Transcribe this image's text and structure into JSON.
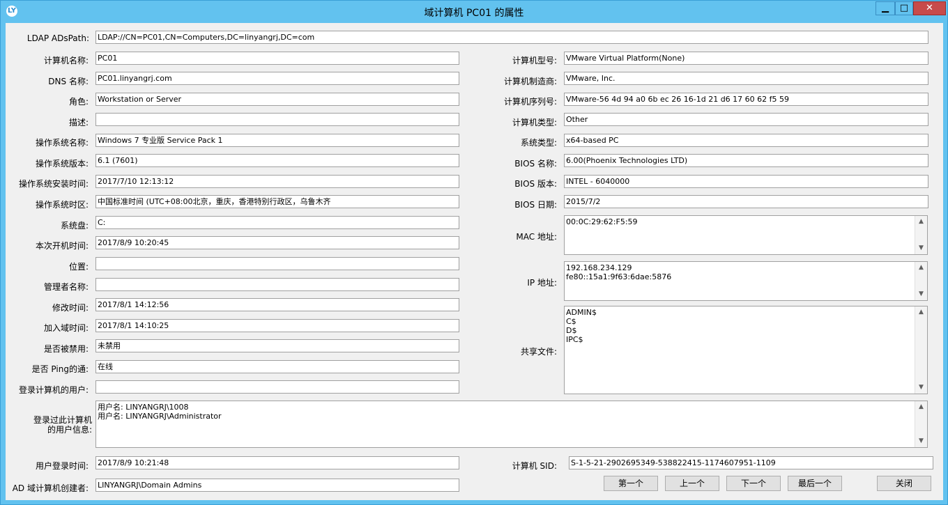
{
  "window": {
    "title": "域计算机 PC01 的属性",
    "icon_text": "LY",
    "controls": {
      "minimize": "▁",
      "maximize": "□",
      "close": "✕"
    }
  },
  "form": {
    "ldap": {
      "label": "LDAP ADsPath:",
      "value": "LDAP://CN=PC01,CN=Computers,DC=linyangrj,DC=com"
    },
    "left": [
      {
        "label": "计算机名称:",
        "value": "PC01"
      },
      {
        "label": "DNS 名称:",
        "value": "PC01.linyangrj.com"
      },
      {
        "label": "角色:",
        "value": "Workstation or Server"
      },
      {
        "label": "描述:",
        "value": ""
      },
      {
        "label": "操作系统名称:",
        "value": "Windows 7 专业版 Service Pack 1"
      },
      {
        "label": "操作系统版本:",
        "value": "6.1 (7601)"
      },
      {
        "label": "操作系统安装时间:",
        "value": "2017/7/10 12:13:12"
      },
      {
        "label": "操作系统时区:",
        "value": "中国标准时间 (UTC+08:00北京，重庆，香港特别行政区，乌鲁木齐"
      },
      {
        "label": "系统盘:",
        "value": "C:"
      },
      {
        "label": "本次开机时间:",
        "value": "2017/8/9 10:20:45"
      },
      {
        "label": "位置:",
        "value": ""
      },
      {
        "label": "管理者名称:",
        "value": ""
      },
      {
        "label": "修改时间:",
        "value": "2017/8/1 14:12:56"
      },
      {
        "label": "加入域时间:",
        "value": "2017/8/1 14:10:25"
      },
      {
        "label": "是否被禁用:",
        "value": "未禁用"
      },
      {
        "label": "是否 Ping的通:",
        "value": "在线"
      },
      {
        "label": "登录计算机的用户:",
        "value": ""
      }
    ],
    "right": [
      {
        "label": "计算机型号:",
        "value": "VMware Virtual Platform(None)"
      },
      {
        "label": "计算机制造商:",
        "value": "VMware, Inc."
      },
      {
        "label": "计算机序列号:",
        "value": "VMware-56 4d 94 a0 6b ec 26 16-1d 21 d6 17 60 62 f5 59"
      },
      {
        "label": "计算机类型:",
        "value": "Other"
      },
      {
        "label": "系统类型:",
        "value": "x64-based PC"
      },
      {
        "label": "BIOS 名称:",
        "value": "6.00(Phoenix Technologies LTD)"
      },
      {
        "label": "BIOS 版本:",
        "value": "INTEL  - 6040000"
      },
      {
        "label": "BIOS 日期:",
        "value": "2015/7/2"
      }
    ],
    "mac": {
      "label": "MAC 地址:",
      "lines": [
        "00:0C:29:62:F5:59"
      ]
    },
    "ip": {
      "label": "IP 地址:",
      "lines": [
        "192.168.234.129",
        "fe80::15a1:9f63:6dae:5876"
      ]
    },
    "shares": {
      "label": "共享文件:",
      "lines": [
        "ADMIN$",
        "C$",
        "D$",
        "IPC$"
      ]
    },
    "logon_users": {
      "label_line1": "登录过此计算机",
      "label_line2": "的用户信息:",
      "lines": [
        "用户名:  LINYANGRJ\\1008",
        "用户名:  LINYANGRJ\\Administrator"
      ]
    },
    "logon_time": {
      "label": "用户登录时间:",
      "value": "2017/8/9 10:21:48"
    },
    "creator": {
      "label": "AD 域计算机创建者:",
      "value": "LINYANGRJ\\Domain Admins"
    },
    "sid": {
      "label": "计算机 SID:",
      "value": "S-1-5-21-2902695349-538822415-1174607951-1109"
    }
  },
  "buttons": {
    "first": "第一个",
    "prev": "上一个",
    "next": "下一个",
    "last": "最后一个",
    "close": "关闭"
  },
  "scroll_glyphs": {
    "up": "▲",
    "down": "▼"
  }
}
